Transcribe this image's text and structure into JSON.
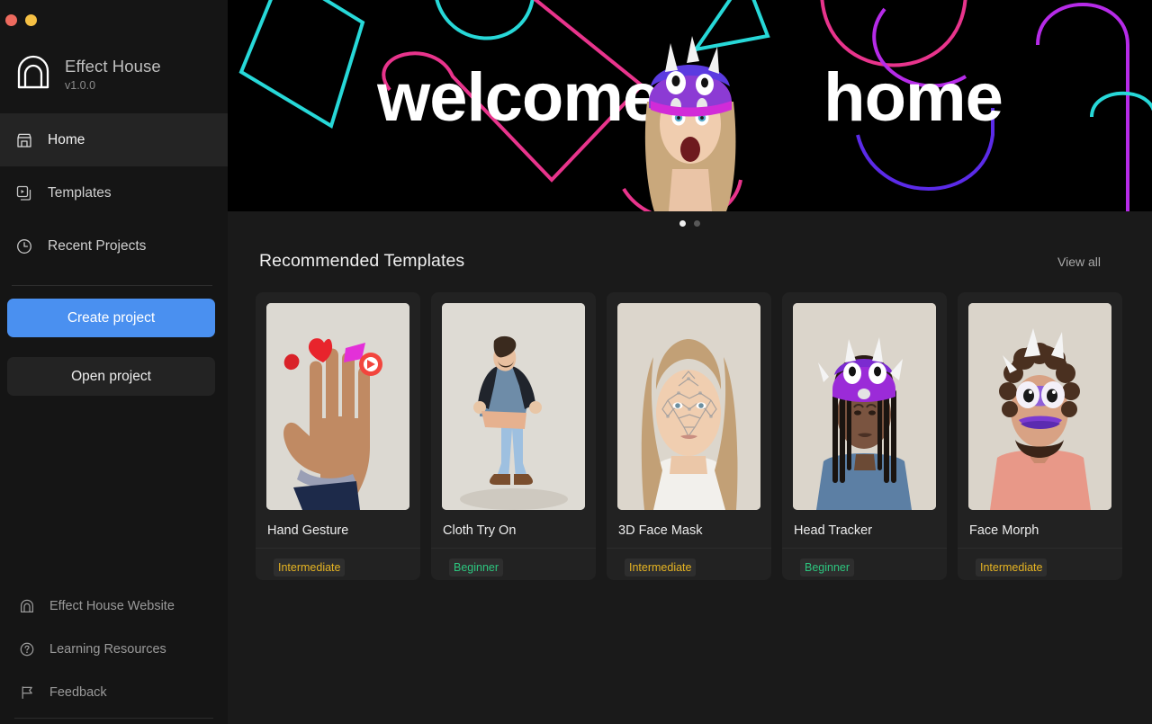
{
  "window": {
    "controls": [
      {
        "name": "close",
        "color": "#ED6A5E"
      },
      {
        "name": "minimize",
        "color": "#F5C044"
      }
    ]
  },
  "sidebar": {
    "brand": {
      "name": "Effect House",
      "version": "v1.0.0",
      "icon": "effect-house-logo-icon"
    },
    "nav": [
      {
        "label": "Home",
        "icon": "storefront-icon",
        "active": true
      },
      {
        "label": "Templates",
        "icon": "templates-stack-icon",
        "active": false
      },
      {
        "label": "Recent Projects",
        "icon": "clock-icon",
        "active": false
      }
    ],
    "actions": {
      "create_label": "Create project",
      "open_label": "Open project",
      "primary_color": "#4A90F0"
    },
    "footer": [
      {
        "label": "Effect House Website",
        "icon": "effect-house-arch-icon"
      },
      {
        "label": "Learning Resources",
        "icon": "question-circle-icon"
      },
      {
        "label": "Feedback",
        "icon": "flag-icon"
      }
    ]
  },
  "banner": {
    "title_left": "welcome",
    "title_right": "home",
    "dots": [
      {
        "active": true
      },
      {
        "active": false
      }
    ]
  },
  "main": {
    "section_title": "Recommended Templates",
    "view_all_label": "View all",
    "templates": [
      {
        "title": "Hand Gesture",
        "badge": "Intermediate",
        "badge_level": "intermediate",
        "thumb": "hand-gesture-thumb"
      },
      {
        "title": "Cloth Try On",
        "badge": "Beginner",
        "badge_level": "beginner",
        "thumb": "cloth-try-on-thumb"
      },
      {
        "title": "3D Face Mask",
        "badge": "Intermediate",
        "badge_level": "intermediate",
        "thumb": "face-mask-thumb"
      },
      {
        "title": "Head Tracker",
        "badge": "Beginner",
        "badge_level": "beginner",
        "thumb": "head-tracker-thumb"
      },
      {
        "title": "Face Morph",
        "badge": "Intermediate",
        "badge_level": "intermediate",
        "thumb": "face-morph-thumb"
      }
    ]
  },
  "colors": {
    "sidebar_bg": "#151515",
    "main_bg": "#1A1A1A",
    "card_bg": "#222222",
    "accent": "#4A90F0",
    "badge_intermediate": "#E6B422",
    "badge_beginner": "#2CC57E"
  }
}
